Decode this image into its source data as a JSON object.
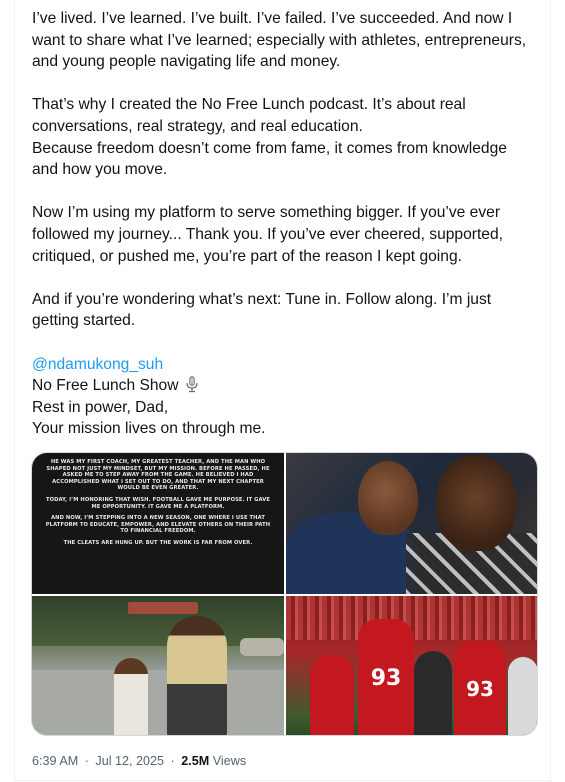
{
  "post": {
    "paragraphs": [
      [
        "I’ve lived. I’ve learned. I’ve built. I’ve failed. I’ve succeeded. And now I",
        "want to share what I’ve learned; especially with athletes, entrepreneurs,",
        "and young people navigating life and money."
      ],
      [
        "That’s why I created the No Free Lunch podcast. It’s about real",
        "conversations, real strategy, and real education.",
        "Because freedom doesn’t come from fame, it comes from knowledge",
        "and how you move."
      ],
      [
        "Now I’m using  my platform to serve something bigger. If you’ve ever",
        "followed my journey... Thank you. If you’ve ever cheered, supported,",
        "critiqued, or pushed me, you’re part of the reason I kept going."
      ],
      [
        "And if you’re wondering what’s next: Tune in. Follow along. I’m just",
        "getting started."
      ]
    ],
    "mention": "@ndamukong_suh",
    "show_line": "No Free Lunch Show",
    "show_icon": "microphone-icon",
    "closing": [
      "Rest in power, Dad,",
      "Your mission lives on through me."
    ]
  },
  "media": {
    "statement_paragraphs": [
      "HE WAS MY FIRST COACH, MY GREATEST TEACHER, AND THE MAN WHO SHAPED NOT JUST MY MINDSET, BUT MY MISSION. BEFORE HE PASSED, HE ASKED ME TO STEP AWAY FROM THE GAME. HE BELIEVED I HAD ACCOMPLISHED WHAT I SET OUT TO DO, AND THAT MY NEXT CHAPTER WOULD BE EVEN GREATER.",
      "TODAY, I’M HONORING THAT WISH. FOOTBALL GAVE ME PURPOSE. IT GAVE ME OPPORTUNITY. IT GAVE ME A PLATFORM.",
      "AND NOW, I’M STEPPING INTO A NEW SEASON, ONE WHERE I USE THAT PLATFORM TO EDUCATE, EMPOWER, AND ELEVATE OTHERS ON THEIR PATH TO FINANCIAL FREEDOM.",
      "THE CLEATS ARE HUNG UP. BUT THE WORK IS FAR FROM OVER."
    ],
    "jersey_number": "93"
  },
  "meta": {
    "time": "6:39 AM",
    "separator": "·",
    "date": "Jul 12, 2025",
    "views_count": "2.5M",
    "views_label": "Views"
  },
  "colors": {
    "link": "#1d9bf0",
    "text": "#0f1419",
    "muted": "#536471"
  }
}
